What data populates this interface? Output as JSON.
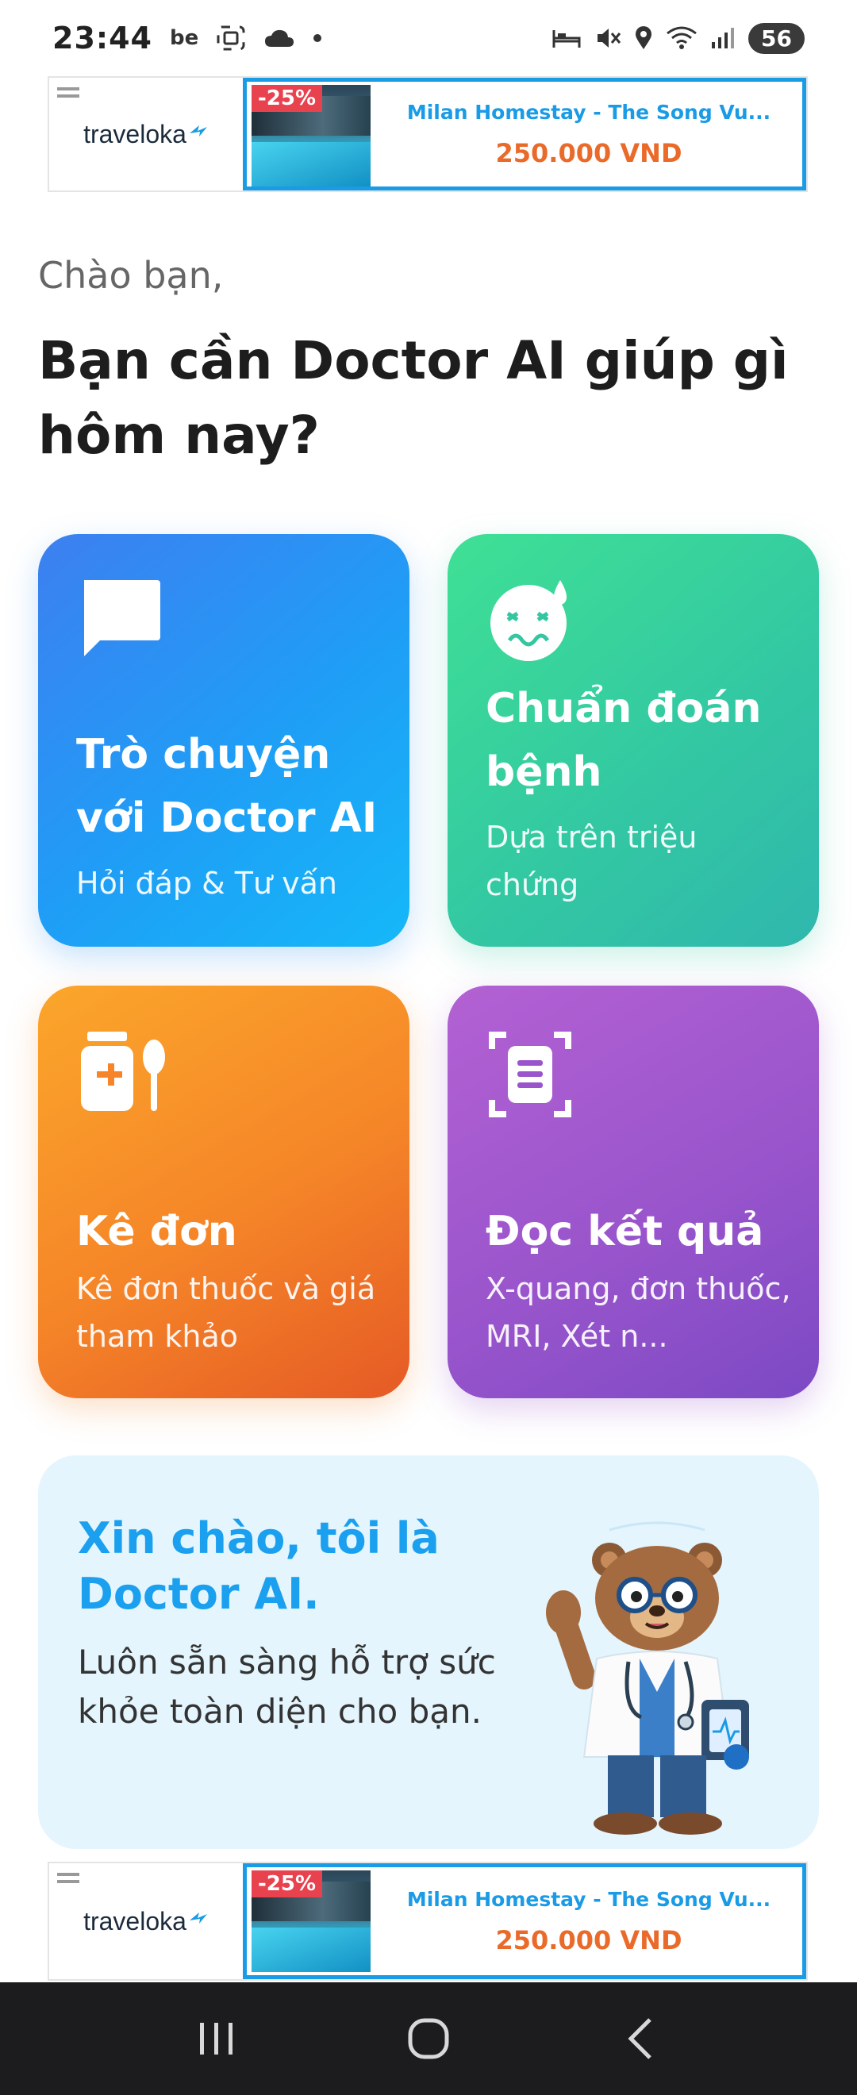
{
  "status_bar": {
    "time": "23:44",
    "carrier_badge": "be",
    "battery": "56"
  },
  "ad_top": {
    "brand": "traveloka",
    "discount": "-25%",
    "title": "Milan Homestay - The Song Vu...",
    "price": "250.000 VND"
  },
  "greeting": "Chào bạn,",
  "headline": "Bạn cần Doctor AI giúp gì hôm nay?",
  "cards": {
    "chat": {
      "title": "Trò chuyện với Doctor AI",
      "subtitle": "Hỏi đáp & Tư vấn",
      "icon": "chat-bubble-icon"
    },
    "diagnosis": {
      "title": "Chuẩn đoán bệnh",
      "subtitle": "Dựa trên triệu chứng",
      "icon": "sick-face-icon"
    },
    "prescription": {
      "title": "Kê đơn",
      "subtitle": "Kê đơn thuốc và giá tham khảo",
      "icon": "medicine-jar-spoon-icon"
    },
    "read_results": {
      "title": "Đọc kết quả",
      "subtitle": "X-quang, đơn thuốc, MRI, Xét n...",
      "icon": "document-scan-icon"
    }
  },
  "intro": {
    "title": "Xin chào, tôi là Doctor AI.",
    "text": "Luôn sẵn sàng hỗ trợ sức khỏe toàn diện cho bạn."
  },
  "ad_bottom": {
    "brand": "traveloka",
    "discount": "-25%",
    "title": "Milan Homestay - The Song Vu...",
    "price": "250.000 VND"
  },
  "colors": {
    "chat_card": "#1f9ef6",
    "diagnosis_card": "#33c9a2",
    "prescription_card": "#f58528",
    "read_card": "#9a55cc",
    "intro_bg": "#e4f5fd",
    "intro_title": "#1aa0ef",
    "ad_border": "#1a9be6",
    "ad_price": "#ea6a2a",
    "ad_discount": "#e8424f"
  },
  "nav_bar": {
    "icons": [
      "recent-apps-icon",
      "home-icon",
      "back-icon"
    ]
  }
}
